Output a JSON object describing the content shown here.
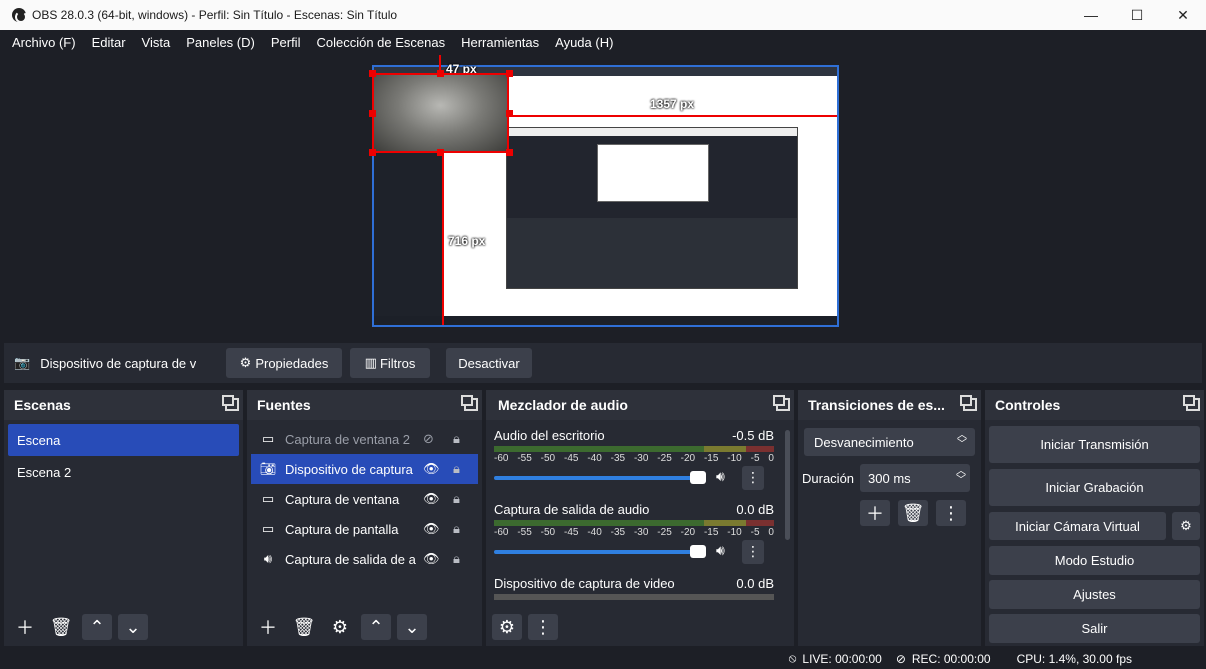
{
  "window": {
    "title": "OBS 28.0.3 (64-bit, windows) - Perfil: Sin Título - Escenas: Sin Título",
    "minimize": "—",
    "maximize": "☐",
    "close": "✕"
  },
  "menu": [
    "Archivo (F)",
    "Editar",
    "Vista",
    "Paneles (D)",
    "Perfil",
    "Colección de Escenas",
    "Herramientas",
    "Ayuda (H)"
  ],
  "preview": {
    "label_top": "47 px",
    "label_right": "1357 px",
    "label_left": "716 px"
  },
  "source_toolbar": {
    "source_name": "Dispositivo de captura de v",
    "properties": "Propiedades",
    "filters": "Filtros",
    "deactivate": "Desactivar"
  },
  "scenes": {
    "title": "Escenas",
    "items": [
      "Escena",
      "Escena 2"
    ],
    "selected": 0
  },
  "sources": {
    "title": "Fuentes",
    "items": [
      {
        "label": "Captura de ventana 2",
        "icon": "window-icon",
        "visible": false
      },
      {
        "label": "Dispositivo de captura",
        "icon": "camera-icon",
        "visible": true,
        "selected": true
      },
      {
        "label": "Captura de ventana",
        "icon": "window-icon",
        "visible": true
      },
      {
        "label": "Captura de pantalla",
        "icon": "monitor-icon",
        "visible": true
      },
      {
        "label": "Captura de salida de a",
        "icon": "speaker-icon",
        "visible": true
      }
    ]
  },
  "mixer": {
    "title": "Mezclador de audio",
    "ticks": [
      "-60",
      "-55",
      "-50",
      "-45",
      "-40",
      "-35",
      "-30",
      "-25",
      "-20",
      "-15",
      "-10",
      "-5",
      "0"
    ],
    "channels": [
      {
        "name": "Audio del escritorio",
        "level": "-0.5 dB"
      },
      {
        "name": "Captura de salida de audio",
        "level": "0.0 dB"
      },
      {
        "name": "Dispositivo de captura de video",
        "level": "0.0 dB"
      }
    ]
  },
  "transitions": {
    "title": "Transiciones de es...",
    "selected": "Desvanecimiento",
    "duration_label": "Duración",
    "duration_value": "300 ms"
  },
  "controls": {
    "title": "Controles",
    "buttons": [
      "Iniciar Transmisión",
      "Iniciar Grabación",
      "Iniciar Cámara Virtual",
      "Modo Estudio",
      "Ajustes",
      "Salir"
    ]
  },
  "status": {
    "live": "LIVE: 00:00:00",
    "rec": "REC: 00:00:00",
    "cpu": "CPU: 1.4%, 30.00 fps"
  }
}
